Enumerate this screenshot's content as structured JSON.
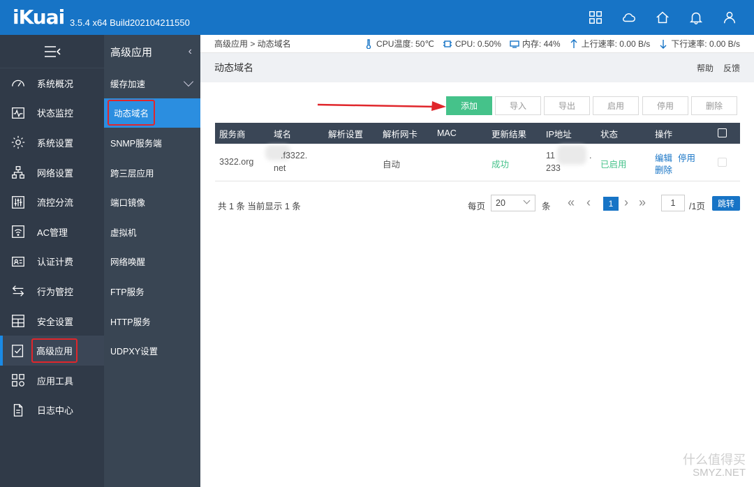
{
  "app": {
    "logo": "iKuai",
    "version": "3.5.4 x64 Build202104211550"
  },
  "topbar": {
    "icons": [
      "grid-icon",
      "cloud-icon",
      "home-icon",
      "bell-icon",
      "user-icon"
    ]
  },
  "leftnav": {
    "items": [
      {
        "label": "系统概况",
        "icon": "gauge-icon"
      },
      {
        "label": "状态监控",
        "icon": "monitor-icon"
      },
      {
        "label": "系统设置",
        "icon": "gear-icon"
      },
      {
        "label": "网络设置",
        "icon": "network-icon"
      },
      {
        "label": "流控分流",
        "icon": "sliders-icon"
      },
      {
        "label": "AC管理",
        "icon": "wifi-icon"
      },
      {
        "label": "认证计费",
        "icon": "idcard-icon"
      },
      {
        "label": "行为管控",
        "icon": "arrows-icon"
      },
      {
        "label": "安全设置",
        "icon": "shield-grid-icon"
      },
      {
        "label": "高级应用",
        "icon": "advanced-icon"
      },
      {
        "label": "应用工具",
        "icon": "tools-icon"
      },
      {
        "label": "日志中心",
        "icon": "log-icon"
      }
    ]
  },
  "subnav": {
    "title": "高级应用",
    "items": [
      "缓存加速",
      "动态域名",
      "SNMP服务端",
      "跨三层应用",
      "端口镜像",
      "虚拟机",
      "网络唤醒",
      "FTP服务",
      "HTTP服务",
      "UDPXY设置"
    ]
  },
  "status": {
    "breadcrumb": "高级应用 > 动态域名",
    "cpu_temp": "CPU温度: 50℃",
    "cpu": "CPU: 0.50%",
    "mem": "内存: 44%",
    "upload": "上行速率: 0.00 B/s",
    "download": "下行速率: 0.00 B/s"
  },
  "page": {
    "title": "动态域名",
    "help": "帮助",
    "feedback": "反馈"
  },
  "toolbar": {
    "add": "添加",
    "import": "导入",
    "export": "导出",
    "enable": "启用",
    "disable": "停用",
    "delete": "删除"
  },
  "table": {
    "headers": [
      "服务商",
      "域名",
      "解析设置",
      "解析网卡",
      "MAC",
      "更新结果",
      "IP地址",
      "状态",
      "操作"
    ],
    "rows": [
      {
        "provider": "3322.org",
        "domain_line1": ".f3322.",
        "domain_line2": "net",
        "resolve_setting": "",
        "nic": "自动",
        "mac": "",
        "result": "成功",
        "ip_line1": "11",
        "ip_line1b": ".",
        "ip_line2": "233",
        "status": "已启用",
        "edit": "编辑",
        "stop": "停用",
        "remove": "删除"
      }
    ]
  },
  "pager": {
    "summary": "共 1 条 当前显示 1 条",
    "per_page_label": "每页",
    "per_page_value": "20",
    "unit": "条",
    "current_page": "1",
    "goto_value": "1",
    "total_pages": "/1页",
    "jump": "跳转"
  },
  "watermark": {
    "text": "什么值得买",
    "site": "SMYZ.NET"
  }
}
